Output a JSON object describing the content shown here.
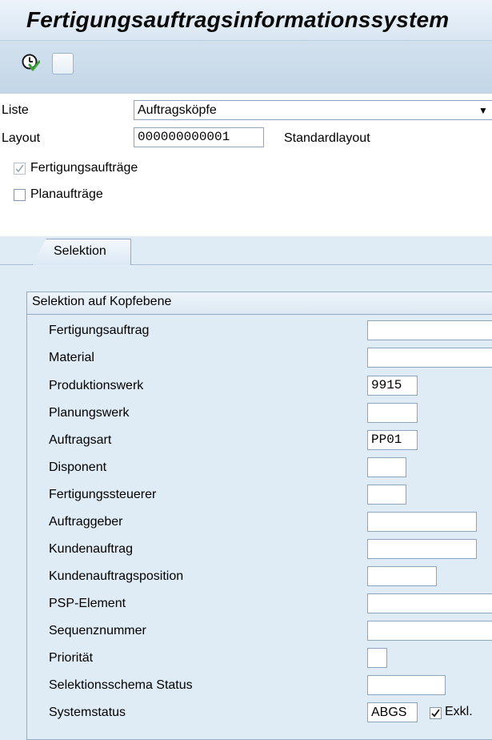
{
  "window": {
    "title": "Fertigungsauftragsinformationssystem"
  },
  "toolbar": {
    "execute_icon": "execute-clock-icon",
    "blank_button": "blank-button"
  },
  "header": {
    "liste_label": "Liste",
    "liste_value": "Auftragsköpfe",
    "layout_label": "Layout",
    "layout_value": "000000000001",
    "layout_description": "Standardlayout",
    "fertigungsauftraege_label": "Fertigungsaufträge",
    "fertigungsauftraege_checked": true,
    "planauftraege_label": "Planaufträge",
    "planauftraege_checked": false
  },
  "tabs": [
    {
      "label": "Selektion",
      "active": true
    }
  ],
  "selection": {
    "group_title": "Selektion auf Kopfebene",
    "rows": [
      {
        "label": "Fertigungsauftrag",
        "value": ""
      },
      {
        "label": "Material",
        "value": ""
      },
      {
        "label": "Produktionswerk",
        "value": "9915"
      },
      {
        "label": "Planungswerk",
        "value": ""
      },
      {
        "label": "Auftragsart",
        "value": "PP01"
      },
      {
        "label": "Disponent",
        "value": ""
      },
      {
        "label": "Fertigungssteuerer",
        "value": ""
      },
      {
        "label": "Auftraggeber",
        "value": ""
      },
      {
        "label": "Kundenauftrag",
        "value": ""
      },
      {
        "label": "Kundenauftragsposition",
        "value": ""
      },
      {
        "label": "PSP-Element",
        "value": ""
      },
      {
        "label": "Sequenznummer",
        "value": ""
      },
      {
        "label": "Priorität",
        "value": ""
      },
      {
        "label": "Selektionsschema Status",
        "value": ""
      },
      {
        "label": "Systemstatus",
        "value": "ABGS"
      }
    ],
    "exkl_label": "Exkl.",
    "exkl_checked": true
  },
  "colors": {
    "background": "#dfebf5",
    "header_background": "#ffffff",
    "border": "#93abc3"
  }
}
